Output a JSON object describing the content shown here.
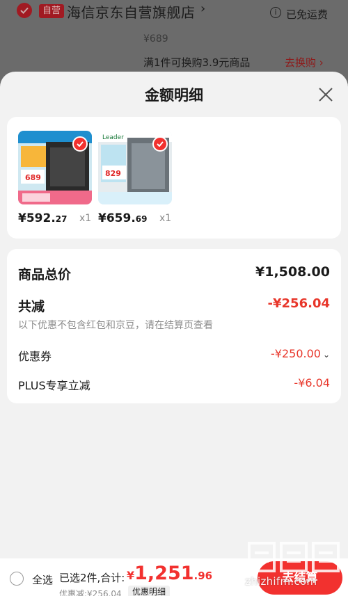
{
  "background": {
    "store_badge": "自营",
    "store_name": "海信京东自营旗舰店",
    "store_chevron": "›",
    "shipping": "已免运费",
    "price_strike": "¥689",
    "promo": "满1件可换购3.9元商品",
    "swap_link": "去换购 ›"
  },
  "sheet": {
    "title": "金额明细",
    "products": [
      {
        "price_int": "¥592.",
        "price_dec": "27",
        "qty": "x1",
        "thumb_price": "689",
        "thumb_color": "#d9eef5"
      },
      {
        "price_int": "¥659.",
        "price_dec": "69",
        "qty": "x1",
        "thumb_price": "829",
        "thumb_color": "#e5ecef"
      }
    ],
    "summary": {
      "total_label": "商品总价",
      "total_value": "¥1,508.00",
      "reduce_label": "共减",
      "reduce_value": "-¥256.04",
      "reduce_note": "以下优惠不包含红包和京豆，请在结算页查看",
      "coupon_label": "优惠券",
      "coupon_value": "-¥250.00",
      "plus_label": "PLUS专享立减",
      "plus_value": "-¥6.04"
    }
  },
  "bottom_bar": {
    "select_all": "全选",
    "selected_count": "已选2件,合计:",
    "total_currency": "¥",
    "total_int": "1,251",
    "total_dec": ".96",
    "discount": "优惠减:¥256.04",
    "detail_chip": "优惠明细",
    "checkout": "去结算"
  },
  "watermark": {
    "text": "zhizhifm.com"
  },
  "colors": {
    "accent_red": "#f2312f",
    "discount_red": "#e8362a"
  }
}
